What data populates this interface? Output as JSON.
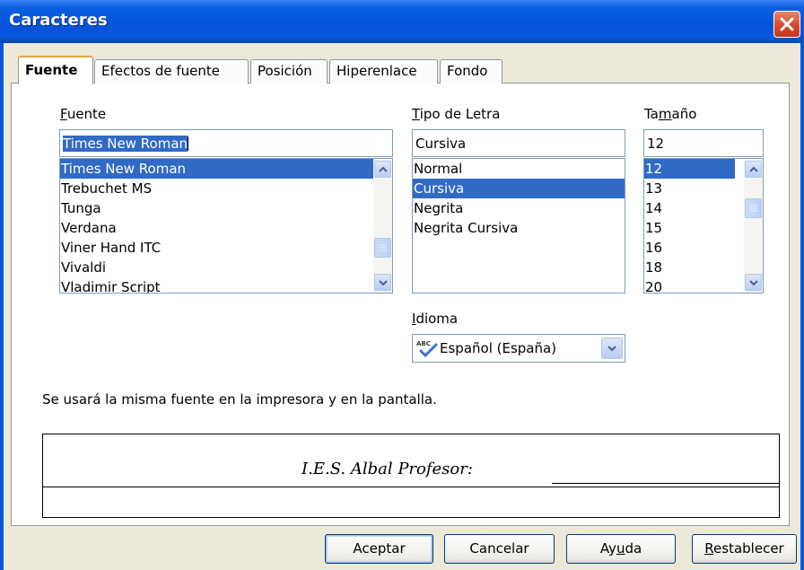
{
  "window": {
    "title": "Caracteres"
  },
  "tabs": [
    {
      "label": "Fuente",
      "active": true
    },
    {
      "label": "Efectos de fuente",
      "active": false
    },
    {
      "label": "Posición",
      "active": false
    },
    {
      "label": "Hiperenlace",
      "active": false
    },
    {
      "label": "Fondo",
      "active": false
    }
  ],
  "font": {
    "label_mnemonic": "F",
    "label_rest": "uente",
    "value": "Times New Roman",
    "items": [
      "Times New Roman",
      "Trebuchet MS",
      "Tunga",
      "Verdana",
      "Viner Hand ITC",
      "Vivaldi",
      "Vladimir Script"
    ],
    "selected": "Times New Roman"
  },
  "style": {
    "label_mnemonic": "T",
    "label_rest": "ipo de Letra",
    "value": "Cursiva",
    "items": [
      "Normal",
      "Cursiva",
      "Negrita",
      "Negrita Cursiva"
    ],
    "selected": "Cursiva"
  },
  "size": {
    "label_pre": "Ta",
    "label_mnemonic": "m",
    "label_post": "año",
    "value": "12",
    "items": [
      "12",
      "13",
      "14",
      "15",
      "16",
      "18",
      "20"
    ],
    "selected": "12"
  },
  "language": {
    "label_mnemonic": "I",
    "label_rest": "dioma",
    "value": "Español (España)",
    "icon": "spellcheck-icon"
  },
  "info_text": "Se usará la misma fuente en la impresora y en la pantalla.",
  "preview_text": "I.E.S. Albal Profesor:",
  "buttons": {
    "accept": "Aceptar",
    "cancel": "Cancelar",
    "help_pre": "Ay",
    "help_mnemonic": "u",
    "help_post": "da",
    "reset_mnemonic": "R",
    "reset_rest": "establecer"
  },
  "colors": {
    "titlebar": "#0553d8",
    "selection": "#316ac5",
    "dialog_bg": "#ece9d8",
    "tab_accent": "#f0a33c"
  }
}
